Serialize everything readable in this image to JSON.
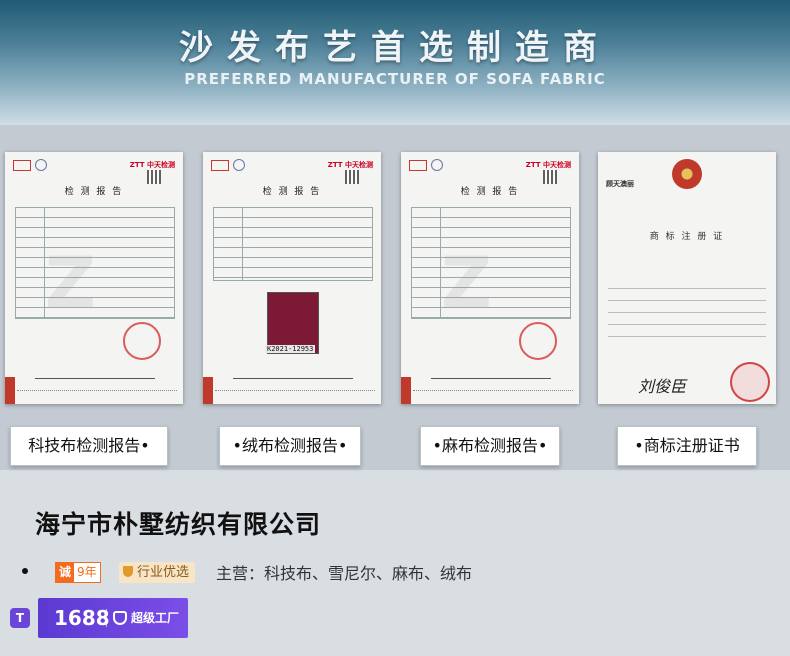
{
  "banner": {
    "title_cn": "沙发布艺首选制造商",
    "title_en": "PREFERRED MANUFACTURER OF SOFA FABRIC"
  },
  "certificates": [
    {
      "label": "科技布检测报告•",
      "doc_title": "检 测 报 告",
      "brand": "ZTT 中天检测"
    },
    {
      "label": "•绒布检测报告•",
      "doc_title": "检 测 报 告",
      "brand": "ZTT 中天检测",
      "swatch_code": "K2021-12953"
    },
    {
      "label": "•麻布检测报告•",
      "doc_title": "检 测 报 告",
      "brand": "ZTT 中天检测"
    },
    {
      "label": "•商标注册证书",
      "doc_title": "商 标 注 册 证",
      "header": "顾天澳丽",
      "signature": "刘俊臣"
    }
  ],
  "company": {
    "name": "海宁市朴墅纺织有限公司",
    "cheng_label": "诚",
    "years": "9年",
    "preferred": "行业优选",
    "main_business": "主营：科技布、雪尼尔、麻布、绒布"
  },
  "badge": {
    "shop_icon": "T",
    "number": "1688",
    "level": "超级工厂"
  },
  "colors": {
    "banner_top": "#1f5b73",
    "cheng_orange": "#f26b1f",
    "badge_purple": "#6b45d8"
  }
}
